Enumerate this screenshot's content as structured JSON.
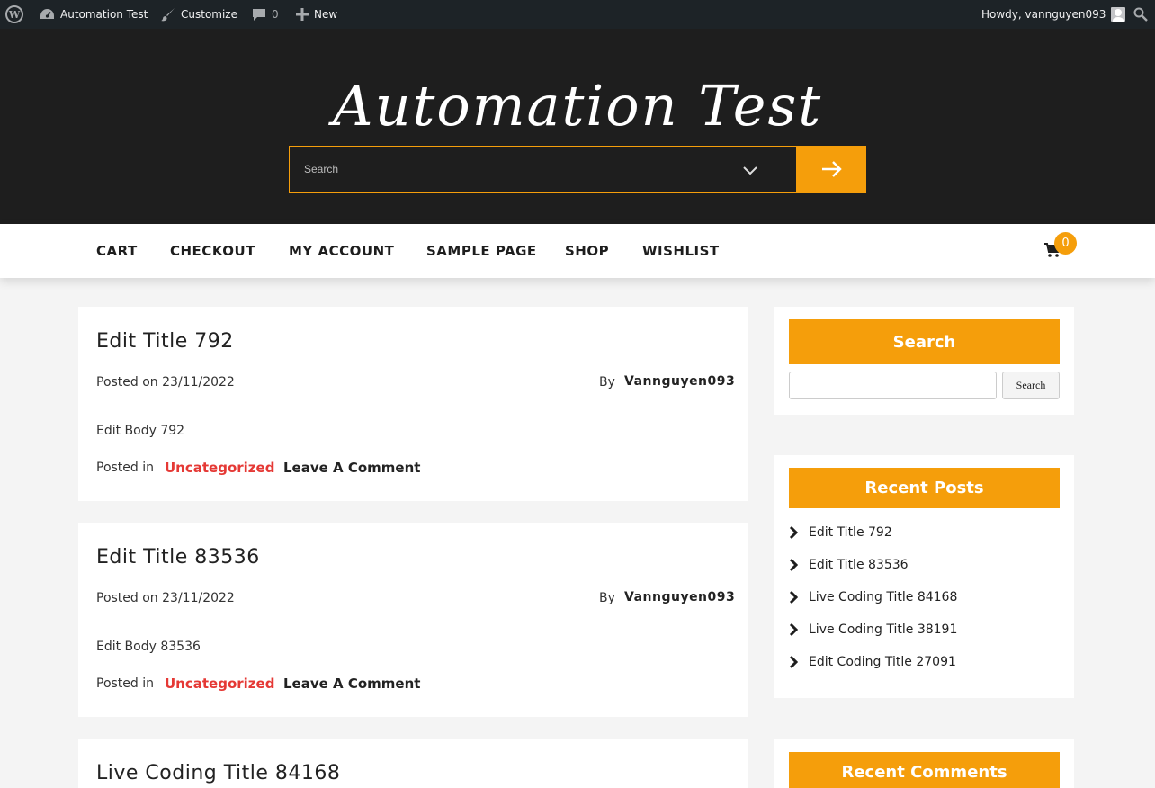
{
  "adminbar": {
    "site_name": "Automation Test",
    "customize": "Customize",
    "comments_count": "0",
    "new_label": "New",
    "howdy": "Howdy, vannguyen093"
  },
  "header": {
    "site_title": "Automation Test",
    "search_placeholder": "Search"
  },
  "nav": {
    "items": [
      "CART",
      "CHECKOUT",
      "MY ACCOUNT",
      "SAMPLE PAGE",
      "SHOP",
      "WISHLIST"
    ],
    "cart_count": "0"
  },
  "posts": [
    {
      "title": "Edit Title 792",
      "posted_on": "Posted on 23/11/2022",
      "by": "By",
      "author": "Vannguyen093",
      "body": "Edit Body 792",
      "posted_in": "Posted in",
      "category": "Uncategorized",
      "comment_link": "Leave A Comment"
    },
    {
      "title": "Edit Title 83536",
      "posted_on": "Posted on 23/11/2022",
      "by": "By",
      "author": "Vannguyen093",
      "body": "Edit Body 83536",
      "posted_in": "Posted in",
      "category": "Uncategorized",
      "comment_link": "Leave A Comment"
    },
    {
      "title": "Live Coding Title 84168"
    }
  ],
  "sidebar": {
    "search_widget": {
      "title": "Search",
      "button": "Search"
    },
    "recent_posts": {
      "title": "Recent Posts",
      "items": [
        "Edit Title 792",
        "Edit Title 83536",
        "Live Coding Title 84168",
        "Live Coding Title 38191",
        "Edit Coding Title 27091"
      ]
    },
    "recent_comments": {
      "title": "Recent Comments"
    }
  },
  "colors": {
    "accent": "#f59e0b",
    "header_bg": "#1e1e1e",
    "adminbar_bg": "#1d2327",
    "category_link": "#e53935"
  }
}
